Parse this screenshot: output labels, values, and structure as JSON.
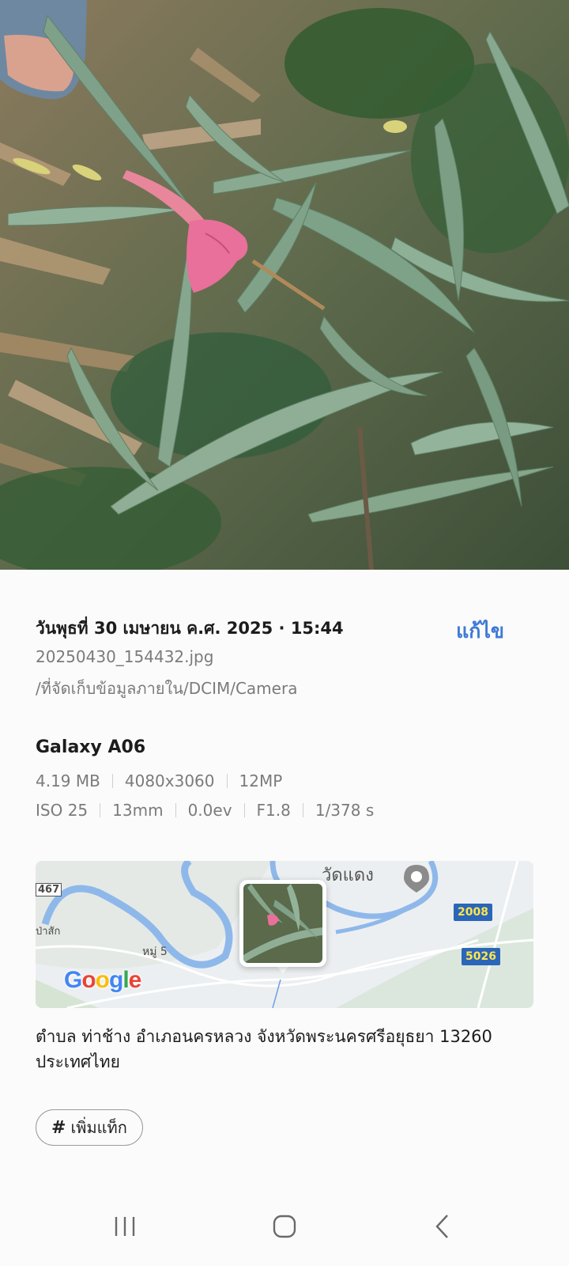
{
  "photo": {
    "description_icon": "photo-image"
  },
  "details": {
    "date_time": "วันพุธที่ 30 เมษายน ค.ศ. 2025 · 15:44",
    "edit_label": "แก้ไข",
    "filename": "20250430_154432.jpg",
    "path": "/ที่จัดเก็บข้อมูลภายใน/DCIM/Camera",
    "device": "Galaxy A06",
    "size": "4.19 MB",
    "resolution": "4080x3060",
    "megapixels": "12MP",
    "iso": "ISO 25",
    "focal_length": "13mm",
    "exposure": "0.0ev",
    "aperture": "F1.8",
    "shutter": "1/378 s"
  },
  "map": {
    "place_label": "วัดแดง",
    "village_label": "หมู่ 5",
    "left_label_top": "467",
    "left_label_side": "ป่าสัก",
    "road_2008": "2008",
    "road_5026": "5026",
    "google_logo": "Google",
    "colors": {
      "river": "#8fb8ea",
      "road_badge": "#2b66b9",
      "accent": "#3e7ad6"
    }
  },
  "address": {
    "line1": "ตำบล ท่าช้าง อำเภอนครหลวง จังหวัดพระนครศรีอยุธยา 13260",
    "line2": "ประเทศไทย"
  },
  "tag": {
    "hash": "#",
    "label": "เพิ่มแท็ก"
  },
  "navbar": {
    "recent_icon": "recent-apps-icon",
    "home_icon": "home-icon",
    "back_icon": "back-icon"
  }
}
